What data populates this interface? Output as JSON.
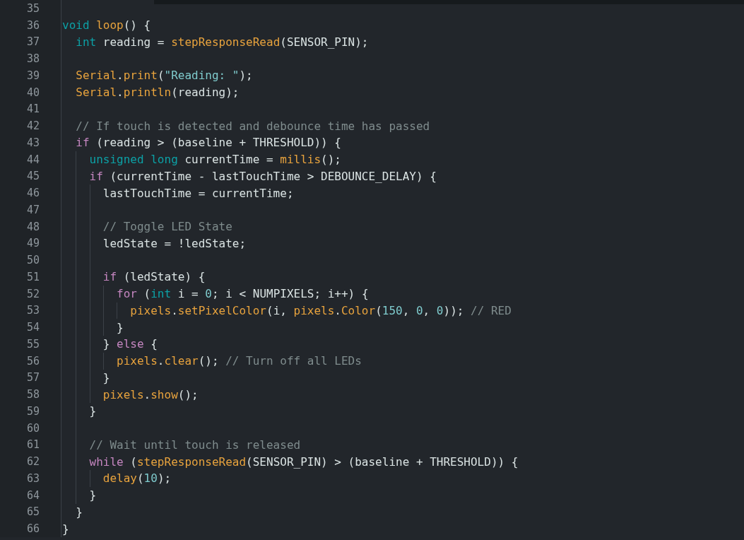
{
  "editor": {
    "lines": [
      {
        "number": "35"
      },
      {
        "number": "36",
        "tokens": [
          {
            "kind": "type",
            "text": "void"
          },
          {
            "kind": "function",
            "text": " loop"
          },
          {
            "kind": "plain",
            "text": "() {"
          }
        ]
      },
      {
        "number": "37",
        "tokens": [
          {
            "kind": "type",
            "text": "  int"
          },
          {
            "kind": "plain",
            "text": " reading = "
          },
          {
            "kind": "function",
            "text": "stepResponseRead"
          },
          {
            "kind": "plain",
            "text": "(SENSOR_PIN);"
          }
        ]
      },
      {
        "number": "38"
      },
      {
        "number": "39",
        "tokens": [
          {
            "kind": "function",
            "text": "  Serial"
          },
          {
            "kind": "plain",
            "text": "."
          },
          {
            "kind": "function",
            "text": "print"
          },
          {
            "kind": "plain",
            "text": "("
          },
          {
            "kind": "string",
            "text": "\"Reading: \""
          },
          {
            "kind": "plain",
            "text": ");"
          }
        ]
      },
      {
        "number": "40",
        "tokens": [
          {
            "kind": "function",
            "text": "  Serial"
          },
          {
            "kind": "plain",
            "text": "."
          },
          {
            "kind": "function",
            "text": "println"
          },
          {
            "kind": "plain",
            "text": "(reading);"
          }
        ]
      },
      {
        "number": "41"
      },
      {
        "number": "42",
        "tokens": [
          {
            "kind": "comment",
            "text": "  // If touch is detected and debounce time has passed"
          }
        ]
      },
      {
        "number": "43",
        "tokens": [
          {
            "kind": "control",
            "text": "  if"
          },
          {
            "kind": "plain",
            "text": " (reading > (baseline + THRESHOLD)) {"
          }
        ]
      },
      {
        "number": "44",
        "tokens": [
          {
            "kind": "type",
            "text": "    unsigned long"
          },
          {
            "kind": "plain",
            "text": " currentTime = "
          },
          {
            "kind": "function",
            "text": "millis"
          },
          {
            "kind": "plain",
            "text": "();"
          }
        ]
      },
      {
        "number": "45",
        "tokens": [
          {
            "kind": "control",
            "text": "    if"
          },
          {
            "kind": "plain",
            "text": " (currentTime - lastTouchTime > DEBOUNCE_DELAY) {"
          }
        ]
      },
      {
        "number": "46",
        "tokens": [
          {
            "kind": "plain",
            "text": "      lastTouchTime = currentTime;"
          }
        ]
      },
      {
        "number": "47"
      },
      {
        "number": "48",
        "tokens": [
          {
            "kind": "comment",
            "text": "      // Toggle LED State"
          }
        ]
      },
      {
        "number": "49",
        "tokens": [
          {
            "kind": "plain",
            "text": "      ledState = !ledState;"
          }
        ]
      },
      {
        "number": "50"
      },
      {
        "number": "51",
        "tokens": [
          {
            "kind": "control",
            "text": "      if"
          },
          {
            "kind": "plain",
            "text": " (ledState) {"
          }
        ]
      },
      {
        "number": "52",
        "tokens": [
          {
            "kind": "control",
            "text": "        for"
          },
          {
            "kind": "plain",
            "text": " ("
          },
          {
            "kind": "type",
            "text": "int"
          },
          {
            "kind": "plain",
            "text": " i = "
          },
          {
            "kind": "number",
            "text": "0"
          },
          {
            "kind": "plain",
            "text": "; i < NUMPIXELS; i++) {"
          }
        ]
      },
      {
        "number": "53",
        "tokens": [
          {
            "kind": "function",
            "text": "          pixels"
          },
          {
            "kind": "plain",
            "text": "."
          },
          {
            "kind": "function",
            "text": "setPixelColor"
          },
          {
            "kind": "plain",
            "text": "(i, "
          },
          {
            "kind": "function",
            "text": "pixels"
          },
          {
            "kind": "plain",
            "text": "."
          },
          {
            "kind": "function",
            "text": "Color"
          },
          {
            "kind": "plain",
            "text": "("
          },
          {
            "kind": "number",
            "text": "150"
          },
          {
            "kind": "plain",
            "text": ", "
          },
          {
            "kind": "number",
            "text": "0"
          },
          {
            "kind": "plain",
            "text": ", "
          },
          {
            "kind": "number",
            "text": "0"
          },
          {
            "kind": "plain",
            "text": ")); "
          },
          {
            "kind": "comment",
            "text": "// RED"
          }
        ]
      },
      {
        "number": "54",
        "tokens": [
          {
            "kind": "plain",
            "text": "        }"
          }
        ]
      },
      {
        "number": "55",
        "tokens": [
          {
            "kind": "plain",
            "text": "      } "
          },
          {
            "kind": "control",
            "text": "else"
          },
          {
            "kind": "plain",
            "text": " {"
          }
        ]
      },
      {
        "number": "56",
        "tokens": [
          {
            "kind": "function",
            "text": "        pixels"
          },
          {
            "kind": "plain",
            "text": "."
          },
          {
            "kind": "function",
            "text": "clear"
          },
          {
            "kind": "plain",
            "text": "(); "
          },
          {
            "kind": "comment",
            "text": "// Turn off all LEDs"
          }
        ]
      },
      {
        "number": "57",
        "tokens": [
          {
            "kind": "plain",
            "text": "      }"
          }
        ]
      },
      {
        "number": "58",
        "tokens": [
          {
            "kind": "function",
            "text": "      pixels"
          },
          {
            "kind": "plain",
            "text": "."
          },
          {
            "kind": "function",
            "text": "show"
          },
          {
            "kind": "plain",
            "text": "();"
          }
        ]
      },
      {
        "number": "59",
        "tokens": [
          {
            "kind": "plain",
            "text": "    }"
          }
        ]
      },
      {
        "number": "60"
      },
      {
        "number": "61",
        "tokens": [
          {
            "kind": "comment",
            "text": "    // Wait until touch is released"
          }
        ]
      },
      {
        "number": "62",
        "tokens": [
          {
            "kind": "control",
            "text": "    while"
          },
          {
            "kind": "plain",
            "text": " ("
          },
          {
            "kind": "function",
            "text": "stepResponseRead"
          },
          {
            "kind": "plain",
            "text": "(SENSOR_PIN) > (baseline + THRESHOLD)) {"
          }
        ]
      },
      {
        "number": "63",
        "tokens": [
          {
            "kind": "function",
            "text": "      delay"
          },
          {
            "kind": "plain",
            "text": "("
          },
          {
            "kind": "number",
            "text": "10"
          },
          {
            "kind": "plain",
            "text": ");"
          }
        ]
      },
      {
        "number": "64",
        "tokens": [
          {
            "kind": "plain",
            "text": "    }"
          }
        ]
      },
      {
        "number": "65",
        "tokens": [
          {
            "kind": "plain",
            "text": "  }"
          }
        ]
      },
      {
        "number": "66",
        "tokens": [
          {
            "kind": "plain",
            "text": "}"
          }
        ]
      }
    ]
  }
}
